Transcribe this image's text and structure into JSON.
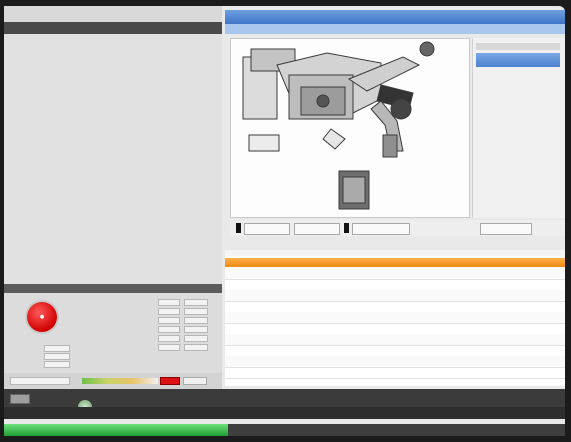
{
  "left_panel": {
    "title_left": "",
    "title_right": "",
    "tabs": [
      "",
      "",
      ""
    ],
    "header": ""
  },
  "status": {
    "header": "",
    "stop_label": "",
    "rows": [
      "",
      "",
      "",
      "",
      "",
      ""
    ],
    "small_rows": [
      "",
      "",
      ""
    ]
  },
  "colors": {
    "accent_blue": "#3f73c6",
    "orange": "#ee8a14",
    "stop_red": "#d00000",
    "progress_green": "#1f9f34"
  },
  "right_panel": {
    "header_title": "",
    "sub_items": [
      "",
      ""
    ],
    "side_selected": ""
  },
  "toolbar": {
    "buttons": [
      "",
      "",
      "",
      ""
    ],
    "caption": ""
  },
  "table": {
    "headers": [
      "",
      "",
      ""
    ],
    "selected_row": [
      "",
      ""
    ]
  },
  "bottom": {
    "progress": 0.4
  }
}
